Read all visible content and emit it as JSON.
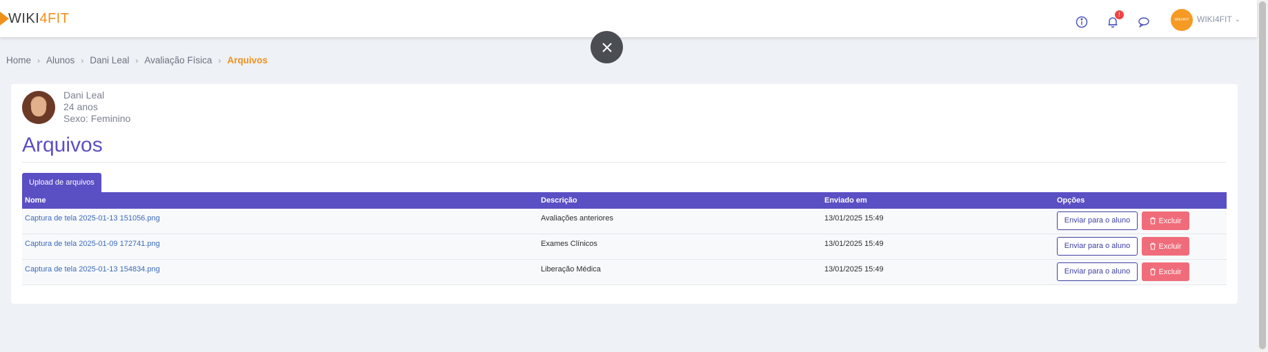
{
  "header": {
    "logo_text_a": "WIKI",
    "logo_text_b": "4FIT",
    "notification_count": "!",
    "user_avatar_text": "WIKI4FIT",
    "user_name": "WIKI4FIT"
  },
  "breadcrumb": {
    "items": [
      "Home",
      "Alunos",
      "Dani Leal",
      "Avaliação Física"
    ],
    "active": "Arquivos"
  },
  "profile": {
    "name": "Dani Leal",
    "age": "24 anos",
    "sex": "Sexo: Feminino"
  },
  "page": {
    "title": "Arquivos",
    "upload_tab": "Upload de arquivos"
  },
  "table": {
    "headers": [
      "Nome",
      "Descrição",
      "Enviado em",
      "Opções"
    ],
    "rows": [
      {
        "name": "Captura de tela 2025-01-13 151056.png",
        "description": "Avaliações anteriores",
        "sent": "13/01/2025 15:49"
      },
      {
        "name": "Captura de tela 2025-01-09 172741.png",
        "description": "Exames Clínicos",
        "sent": "13/01/2025 15:49"
      },
      {
        "name": "Captura de tela 2025-01-13 154834.png",
        "description": "Liberação Médica",
        "sent": "13/01/2025 15:49"
      }
    ],
    "send_label": "Enviar para o aluno",
    "delete_label": "Excluir"
  },
  "colors": {
    "brand_orange": "#f0901c",
    "primary_purple": "#5b4fc4",
    "danger": "#f06c7a"
  }
}
